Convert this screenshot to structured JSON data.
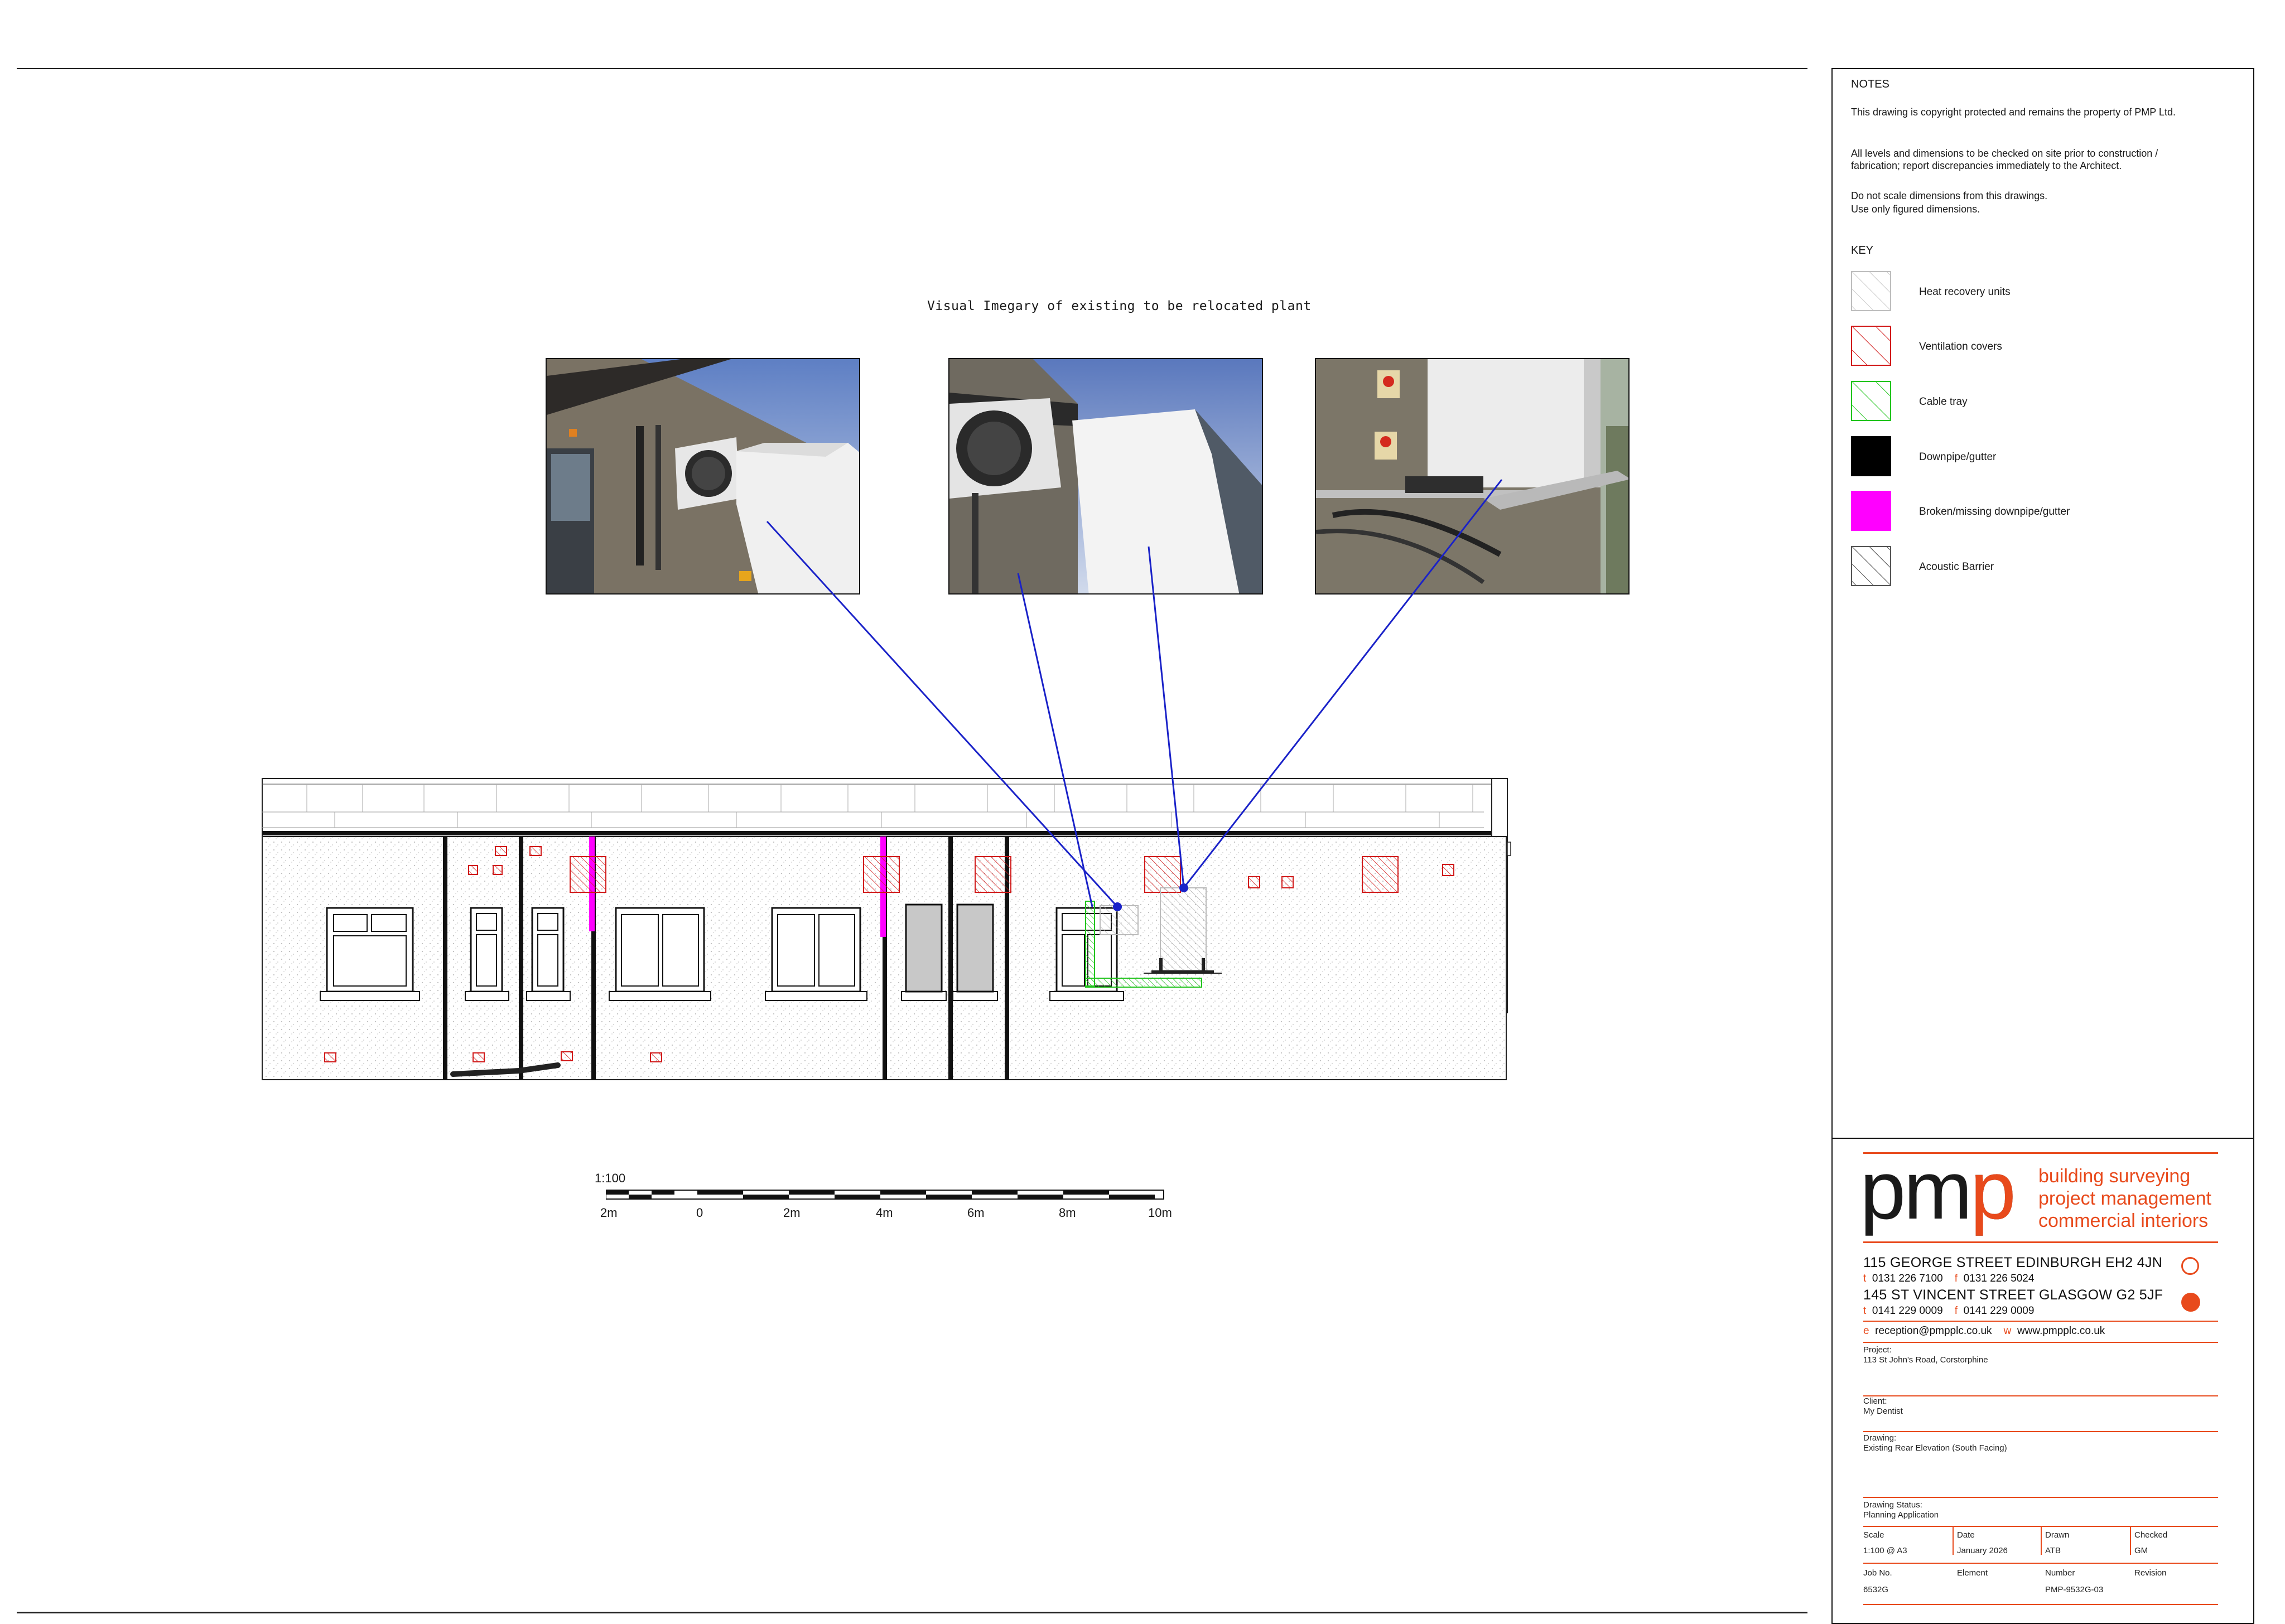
{
  "sheet": {
    "visual_title": "Visual Imegary of existing to be relocated plant"
  },
  "notes": {
    "heading": "NOTES",
    "p1": "This drawing is copyright protected and remains the property of PMP Ltd.",
    "p2": "All levels and dimensions to be checked on site prior to construction / fabrication; report discrepancies immediately to the Architect.",
    "p3a": "Do not scale dimensions from this drawings.",
    "p3b": "Use only figured dimensions."
  },
  "key": {
    "heading": "KEY",
    "items": [
      {
        "label": "Heat recovery units",
        "color": "#bdbdbd"
      },
      {
        "label": "Ventilation covers",
        "color": "#d11a1a"
      },
      {
        "label": "Cable tray",
        "color": "#22c41e"
      },
      {
        "label": "Downpipe/gutter",
        "color": "#000000"
      },
      {
        "label": "Broken/missing downpipe/gutter",
        "color": "#ff00ff"
      },
      {
        "label": "Acoustic Barrier",
        "color": "#444444"
      }
    ]
  },
  "scale_bar": {
    "ratio": "1:100",
    "ticks": [
      "2m",
      "0",
      "2m",
      "4m",
      "6m",
      "8m",
      "10m"
    ]
  },
  "title_block": {
    "logo": "pmp",
    "tagline": [
      "building surveying",
      "project management",
      "commercial interiors"
    ],
    "edinburgh": {
      "address": "115 GEORGE STREET  EDINBURGH  EH2 4JN",
      "t": "0131 226 7100",
      "f": "0131 226 5024"
    },
    "glasgow": {
      "address": "145  ST VINCENT STREET  GLASGOW  G2 5JF",
      "t": "0141 229 0009",
      "f": "0141 229 0009"
    },
    "email": "reception@pmpplc.co.uk",
    "web": "www.pmpplc.co.uk",
    "t_prefix": "t",
    "f_prefix": "f",
    "e_prefix": "e",
    "w_prefix": "w",
    "project_label": "Project:",
    "project": "113 St John's Road, Corstorphine",
    "client_label": "Client:",
    "client": "My Dentist",
    "drawing_label": "Drawing:",
    "drawing": "Existing Rear Elevation (South Facing)",
    "status_label": "Drawing Status:",
    "status": "Planning Application",
    "scale_label": "Scale",
    "scale": "1:100 @ A3",
    "date_label": "Date",
    "date": "January 2026",
    "drawn_label": "Drawn",
    "drawn": "ATB",
    "checked_label": "Checked",
    "checked": "GM",
    "jobno_label": "Job No.",
    "jobno": "6532G",
    "element_label": "Element",
    "element": "",
    "number_label": "Number",
    "number": "PMP-9532G-03",
    "revision_label": "Revision",
    "revision": ""
  }
}
